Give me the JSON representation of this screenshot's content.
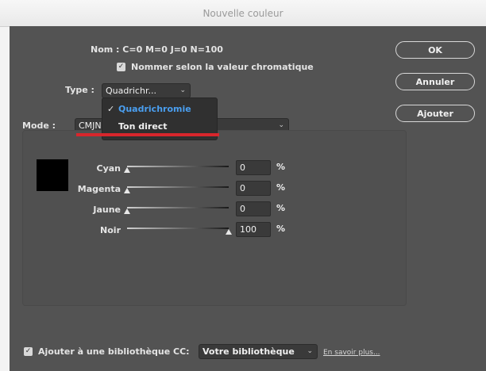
{
  "window": {
    "title": "Nouvelle couleur"
  },
  "name_row": {
    "text": "Nom : C=0 M=0 J=0 N=100"
  },
  "name_by_value": {
    "label": "Nommer selon la valeur chromatique",
    "checked": true
  },
  "type": {
    "label": "Type :",
    "value": "Quadrichr..."
  },
  "type_menu": {
    "items": [
      {
        "label": "Quadrichromie",
        "selected": true,
        "color": "#4a9ff0"
      },
      {
        "label": "Ton direct",
        "selected": false
      }
    ]
  },
  "mode": {
    "label": "Mode :",
    "value": "CMJN"
  },
  "swatch_color": "#000000",
  "sliders": [
    {
      "label": "Cyan",
      "value": "0",
      "unit": "%",
      "fraction": 0
    },
    {
      "label": "Magenta",
      "value": "0",
      "unit": "%",
      "fraction": 0
    },
    {
      "label": "Jaune",
      "value": "0",
      "unit": "%",
      "fraction": 0
    },
    {
      "label": "Noir",
      "value": "100",
      "unit": "%",
      "fraction": 1
    }
  ],
  "buttons": {
    "ok": "OK",
    "cancel": "Annuler",
    "add": "Ajouter"
  },
  "library": {
    "label": "Ajouter à une bibliothèque CC:",
    "checked": true,
    "value": "Votre bibliothèque",
    "link": "En savoir plus..."
  },
  "annotation_color": "#d8262c"
}
